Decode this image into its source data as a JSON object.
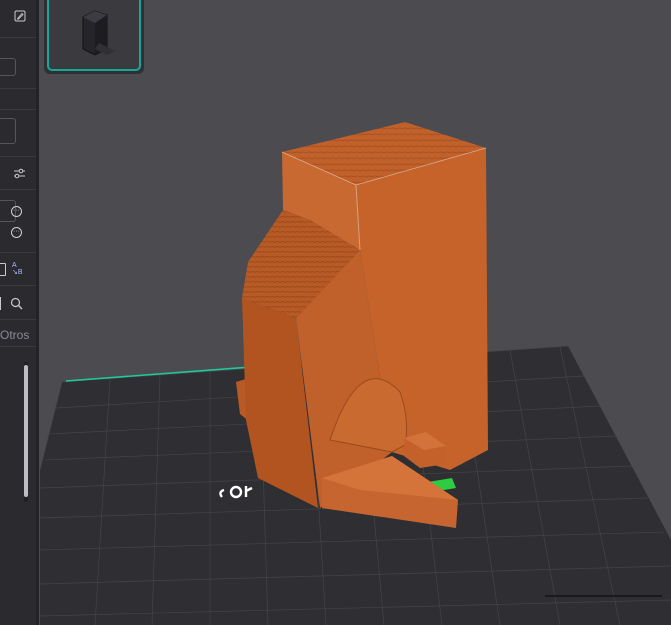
{
  "left_panel": {
    "tab_label": "Otros",
    "icons": [
      "edit-icon",
      "sliders-icon",
      "more-options-icon",
      "more-options-icon",
      "copy-icon",
      "rename-icon",
      "search-icon"
    ]
  },
  "object_thumbnail": {
    "selected": true,
    "accent": "#14a99c"
  },
  "viewport": {
    "bed_color": "#2f2f33",
    "grid_color": "#444449",
    "model_color": "#c5632a",
    "x_axis_color": "#1fc99a",
    "origin_marker_color": "#2ecc40"
  },
  "colors": {
    "background": "#4b4b50",
    "panel": "#2b2b2f",
    "accent": "#14a99c"
  }
}
